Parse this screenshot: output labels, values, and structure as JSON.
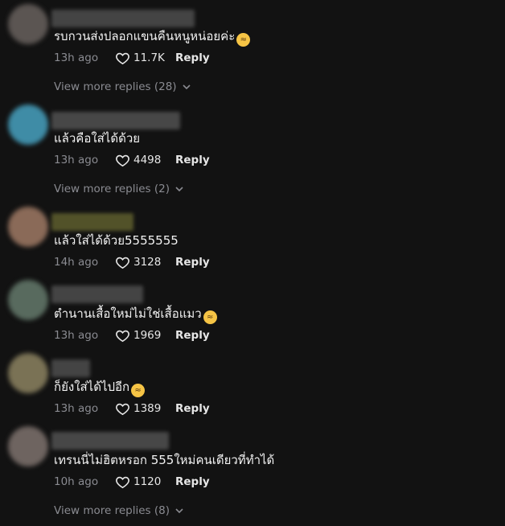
{
  "comments": [
    {
      "text": "รบกวนส่งปลอกแขนคืนหนูหน่อยค่ะ",
      "emoji_icon": "grinning-squinting-face",
      "time": "13h ago",
      "likes": "11.7K",
      "reply_label": "Reply",
      "view_more": "View more replies (28)",
      "avatar_color": "#5b5552",
      "name_color": "#4a4a4a"
    },
    {
      "text": "แล้วคือใส่ได้ด้วย",
      "time": "13h ago",
      "likes": "4498",
      "reply_label": "Reply",
      "view_more": "View more replies (2)",
      "avatar_color": "#3f8ca6",
      "name_color": "#4d4d4d"
    },
    {
      "text": "แล้วใส่ได้ด้วย5555555",
      "time": "14h ago",
      "likes": "3128",
      "reply_label": "Reply",
      "avatar_color": "#8a6a58",
      "name_color": "#5a5a2c"
    },
    {
      "text": "ตำนานเสื้อใหม่ไม่ใช่เสื้อแมว",
      "emoji_icon": "grinning-sweat-face",
      "time": "13h ago",
      "likes": "1969",
      "reply_label": "Reply",
      "avatar_color": "#586a5e",
      "name_color": "#4a4a4a"
    },
    {
      "text": "ก็ยังใส่ได้ไปอีก",
      "emoji_icon": "rolling-laughing-face",
      "time": "13h ago",
      "likes": "1389",
      "reply_label": "Reply",
      "avatar_color": "#7a7255",
      "name_color": "#4a4a4a"
    },
    {
      "text": "เทรนนี่ไม่ฮิตหรอก 555ใหม่คนเดียวที่ทำได้",
      "time": "10h ago",
      "likes": "1120",
      "reply_label": "Reply",
      "view_more": "View more replies (8)",
      "avatar_color": "#6e6460",
      "name_color": "#4d4d4d"
    }
  ]
}
